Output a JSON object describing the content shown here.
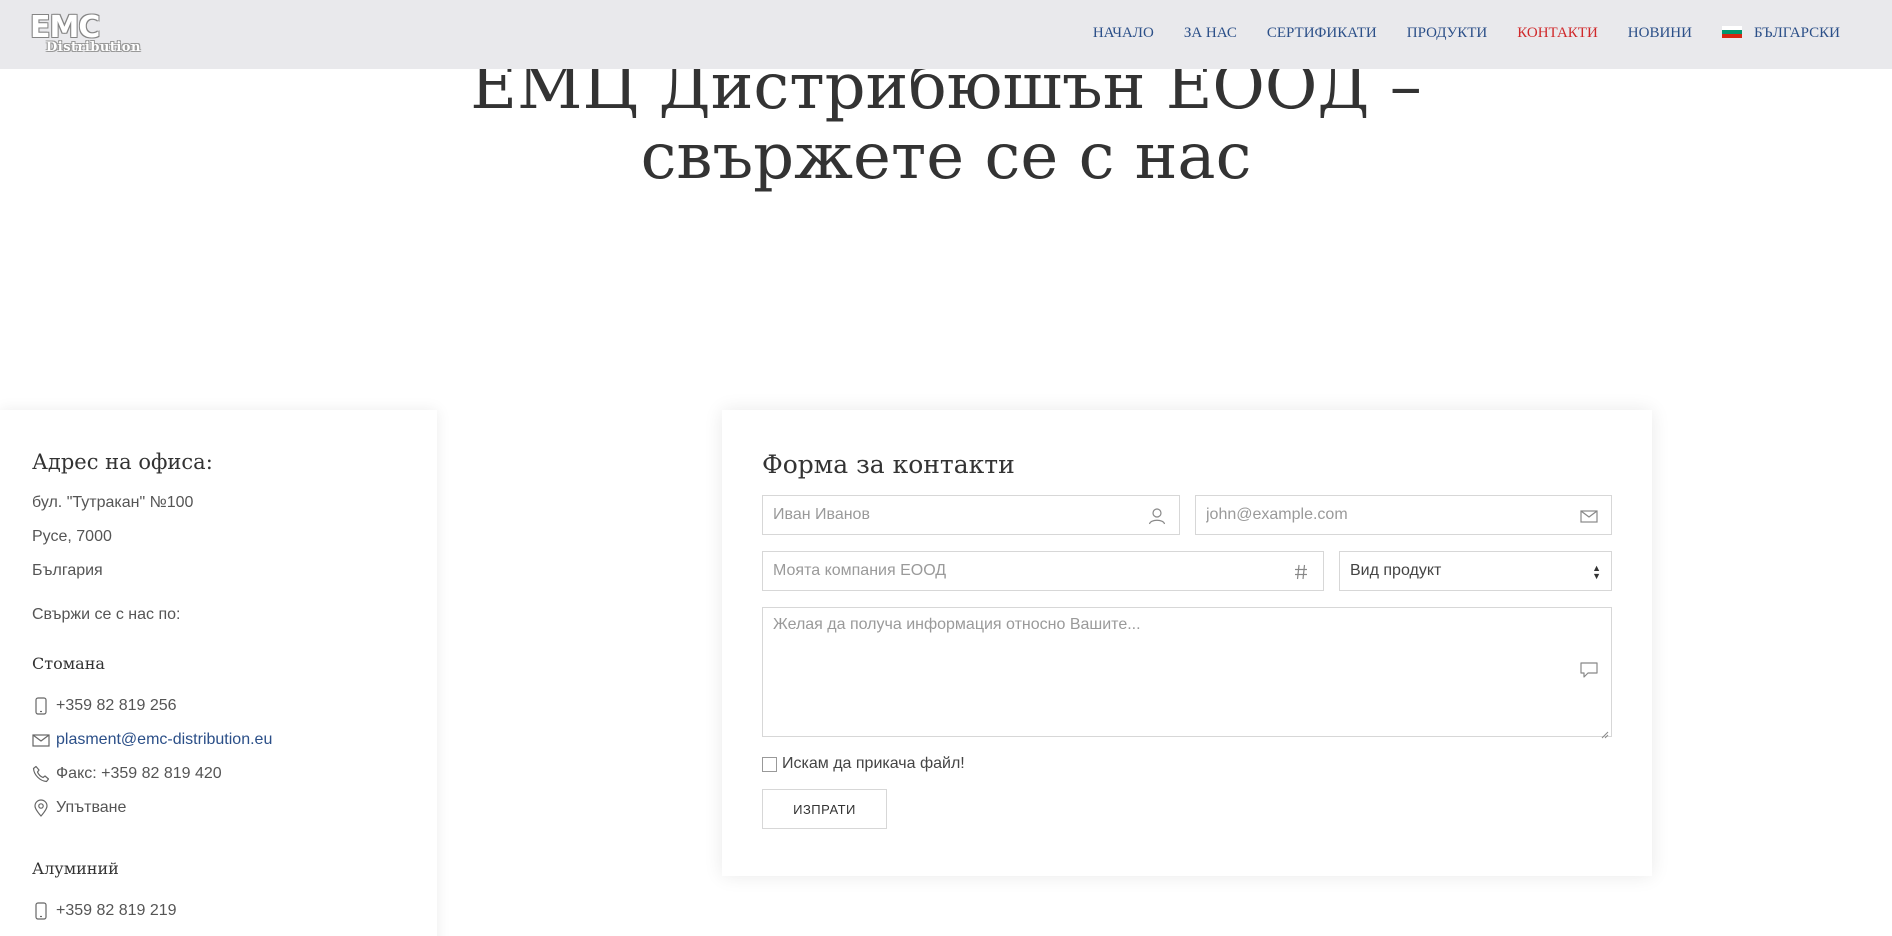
{
  "header": {
    "logo_main": "EMC",
    "logo_sub": "Distribution",
    "nav": [
      {
        "label": "НАЧАЛО"
      },
      {
        "label": "ЗА НАС"
      },
      {
        "label": "СЕРТИФИКАТИ"
      },
      {
        "label": "ПРОДУКТИ"
      },
      {
        "label": "КОНТАКТИ"
      },
      {
        "label": "НОВИНИ"
      }
    ],
    "active_nav": "КОНТАКТИ",
    "language": "БЪЛГАРСКИ",
    "flag_colors": [
      "#ffffff",
      "#00966e",
      "#d62612"
    ],
    "colors": {
      "nav": "#2b4f88",
      "active": "#d0282a",
      "header_bg": "#e9e9ec"
    }
  },
  "hero": {
    "title_line1": "ЕМЦ Дистрибюшън ЕООД –",
    "title_line2": "свържете се с нас"
  },
  "office": {
    "heading": "Адрес на офиса:",
    "address": [
      "бул. \"Тутракан\" №100",
      "Русе, 7000",
      "България"
    ],
    "contact_by": "Свържи се с нас по:",
    "steel": {
      "title": "Стомана",
      "phone": "+359 82 819 256",
      "email": "plasment@emc-distribution.eu",
      "fax": "Факс: +359 82 819 420",
      "directions": "Упътване",
      "icons": [
        "mobile-icon",
        "envelope-icon",
        "phone-icon",
        "map-pin-icon"
      ]
    },
    "aluminium": {
      "title": "Алуминий",
      "phone": "+359 82 819 219"
    }
  },
  "form": {
    "heading": "Форма за контакти",
    "name_placeholder": "Иван Иванов",
    "email_placeholder": "john@example.com",
    "company_placeholder": "Моята компания ЕООД",
    "product_select": "Вид продукт",
    "message_placeholder": "Желая да получа информация относно Вашите...",
    "attach_label": "Искам да прикача файл!",
    "attach_checked": false,
    "submit_label": "ИЗПРАТИ"
  }
}
